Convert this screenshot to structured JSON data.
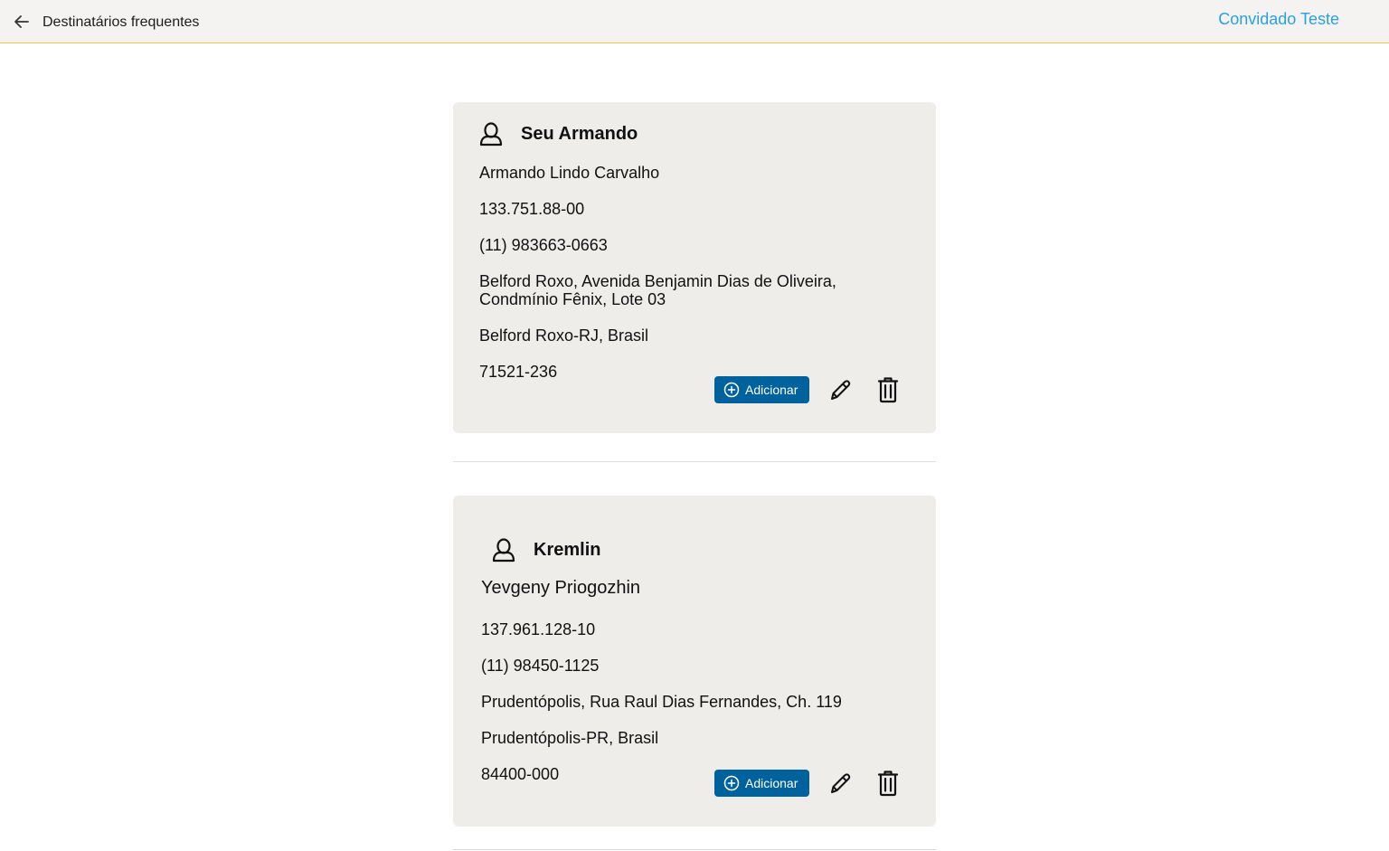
{
  "header": {
    "title": "Destinatários frequentes",
    "user_name": "Convidado Teste"
  },
  "recipients": [
    {
      "nickname": "Seu Armando",
      "full_name": "Armando Lindo Carvalho",
      "document": "133.751.88-00",
      "phone": "(11) 983663-0663",
      "address_line1": "Belford Roxo, Avenida Benjamin Dias de Oliveira,",
      "address_line2": "Condmínio Fênix, Lote 03",
      "city": "Belford Roxo-RJ, Brasil",
      "cep": "71521-236",
      "add_label": "Adicionar"
    },
    {
      "nickname": "Kremlin",
      "full_name": "Yevgeny Priogozhin",
      "document": "137.961.128-10",
      "phone": "(11) 98450-1125",
      "address_line1": "Prudentópolis, Rua Raul Dias Fernandes, Ch. 119",
      "city": "Prudentópolis-PR, Brasil",
      "cep": "84400-000",
      "add_label": "Adicionar"
    }
  ],
  "colors": {
    "accent": "#00629c",
    "link": "#2aa0e0",
    "card_bg": "#eeedea",
    "header_bg": "#f4f3f1",
    "header_border": "#e8c84a"
  },
  "icons": {
    "back": "arrow-left-icon",
    "person": "person-outline-icon",
    "add": "plus-circle-icon",
    "edit": "pencil-icon",
    "delete": "trash-icon"
  }
}
